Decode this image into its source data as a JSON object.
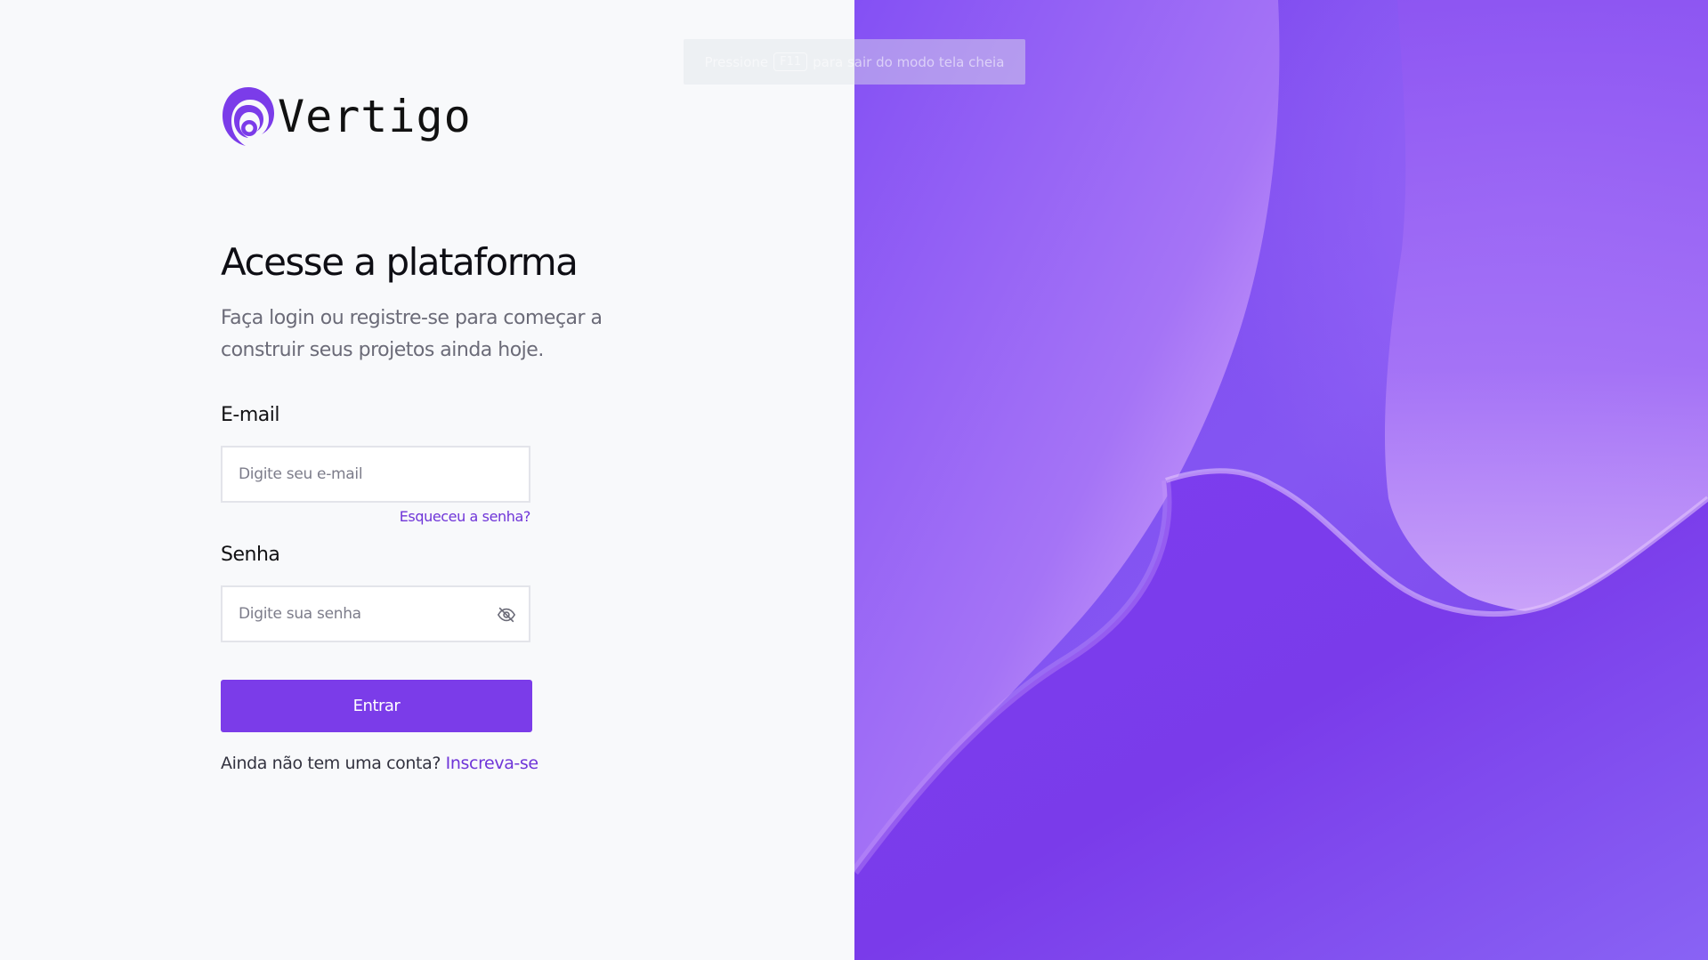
{
  "brand": {
    "name": "Vertigo",
    "accent_color": "#7b3ce9",
    "logo_icon": "vertigo-logo-icon"
  },
  "fullscreen_notice": {
    "prefix": "Pressione",
    "key": "F11",
    "suffix": "para sair do modo tela cheia"
  },
  "login": {
    "title": "Acesse a plataforma",
    "subtitle": "Faça login ou registre-se para começar a construir seus projetos ainda hoje.",
    "email": {
      "label": "E-mail",
      "placeholder": "Digite seu e-mail",
      "value": ""
    },
    "forgot_password": "Esqueceu a senha?",
    "password": {
      "label": "Senha",
      "placeholder": "Digite sua senha",
      "value": "",
      "toggle_icon": "eye-off-icon"
    },
    "submit_label": "Entrar",
    "signup_prompt": "Ainda não tem uma conta?",
    "signup_link": "Inscreva-se"
  }
}
